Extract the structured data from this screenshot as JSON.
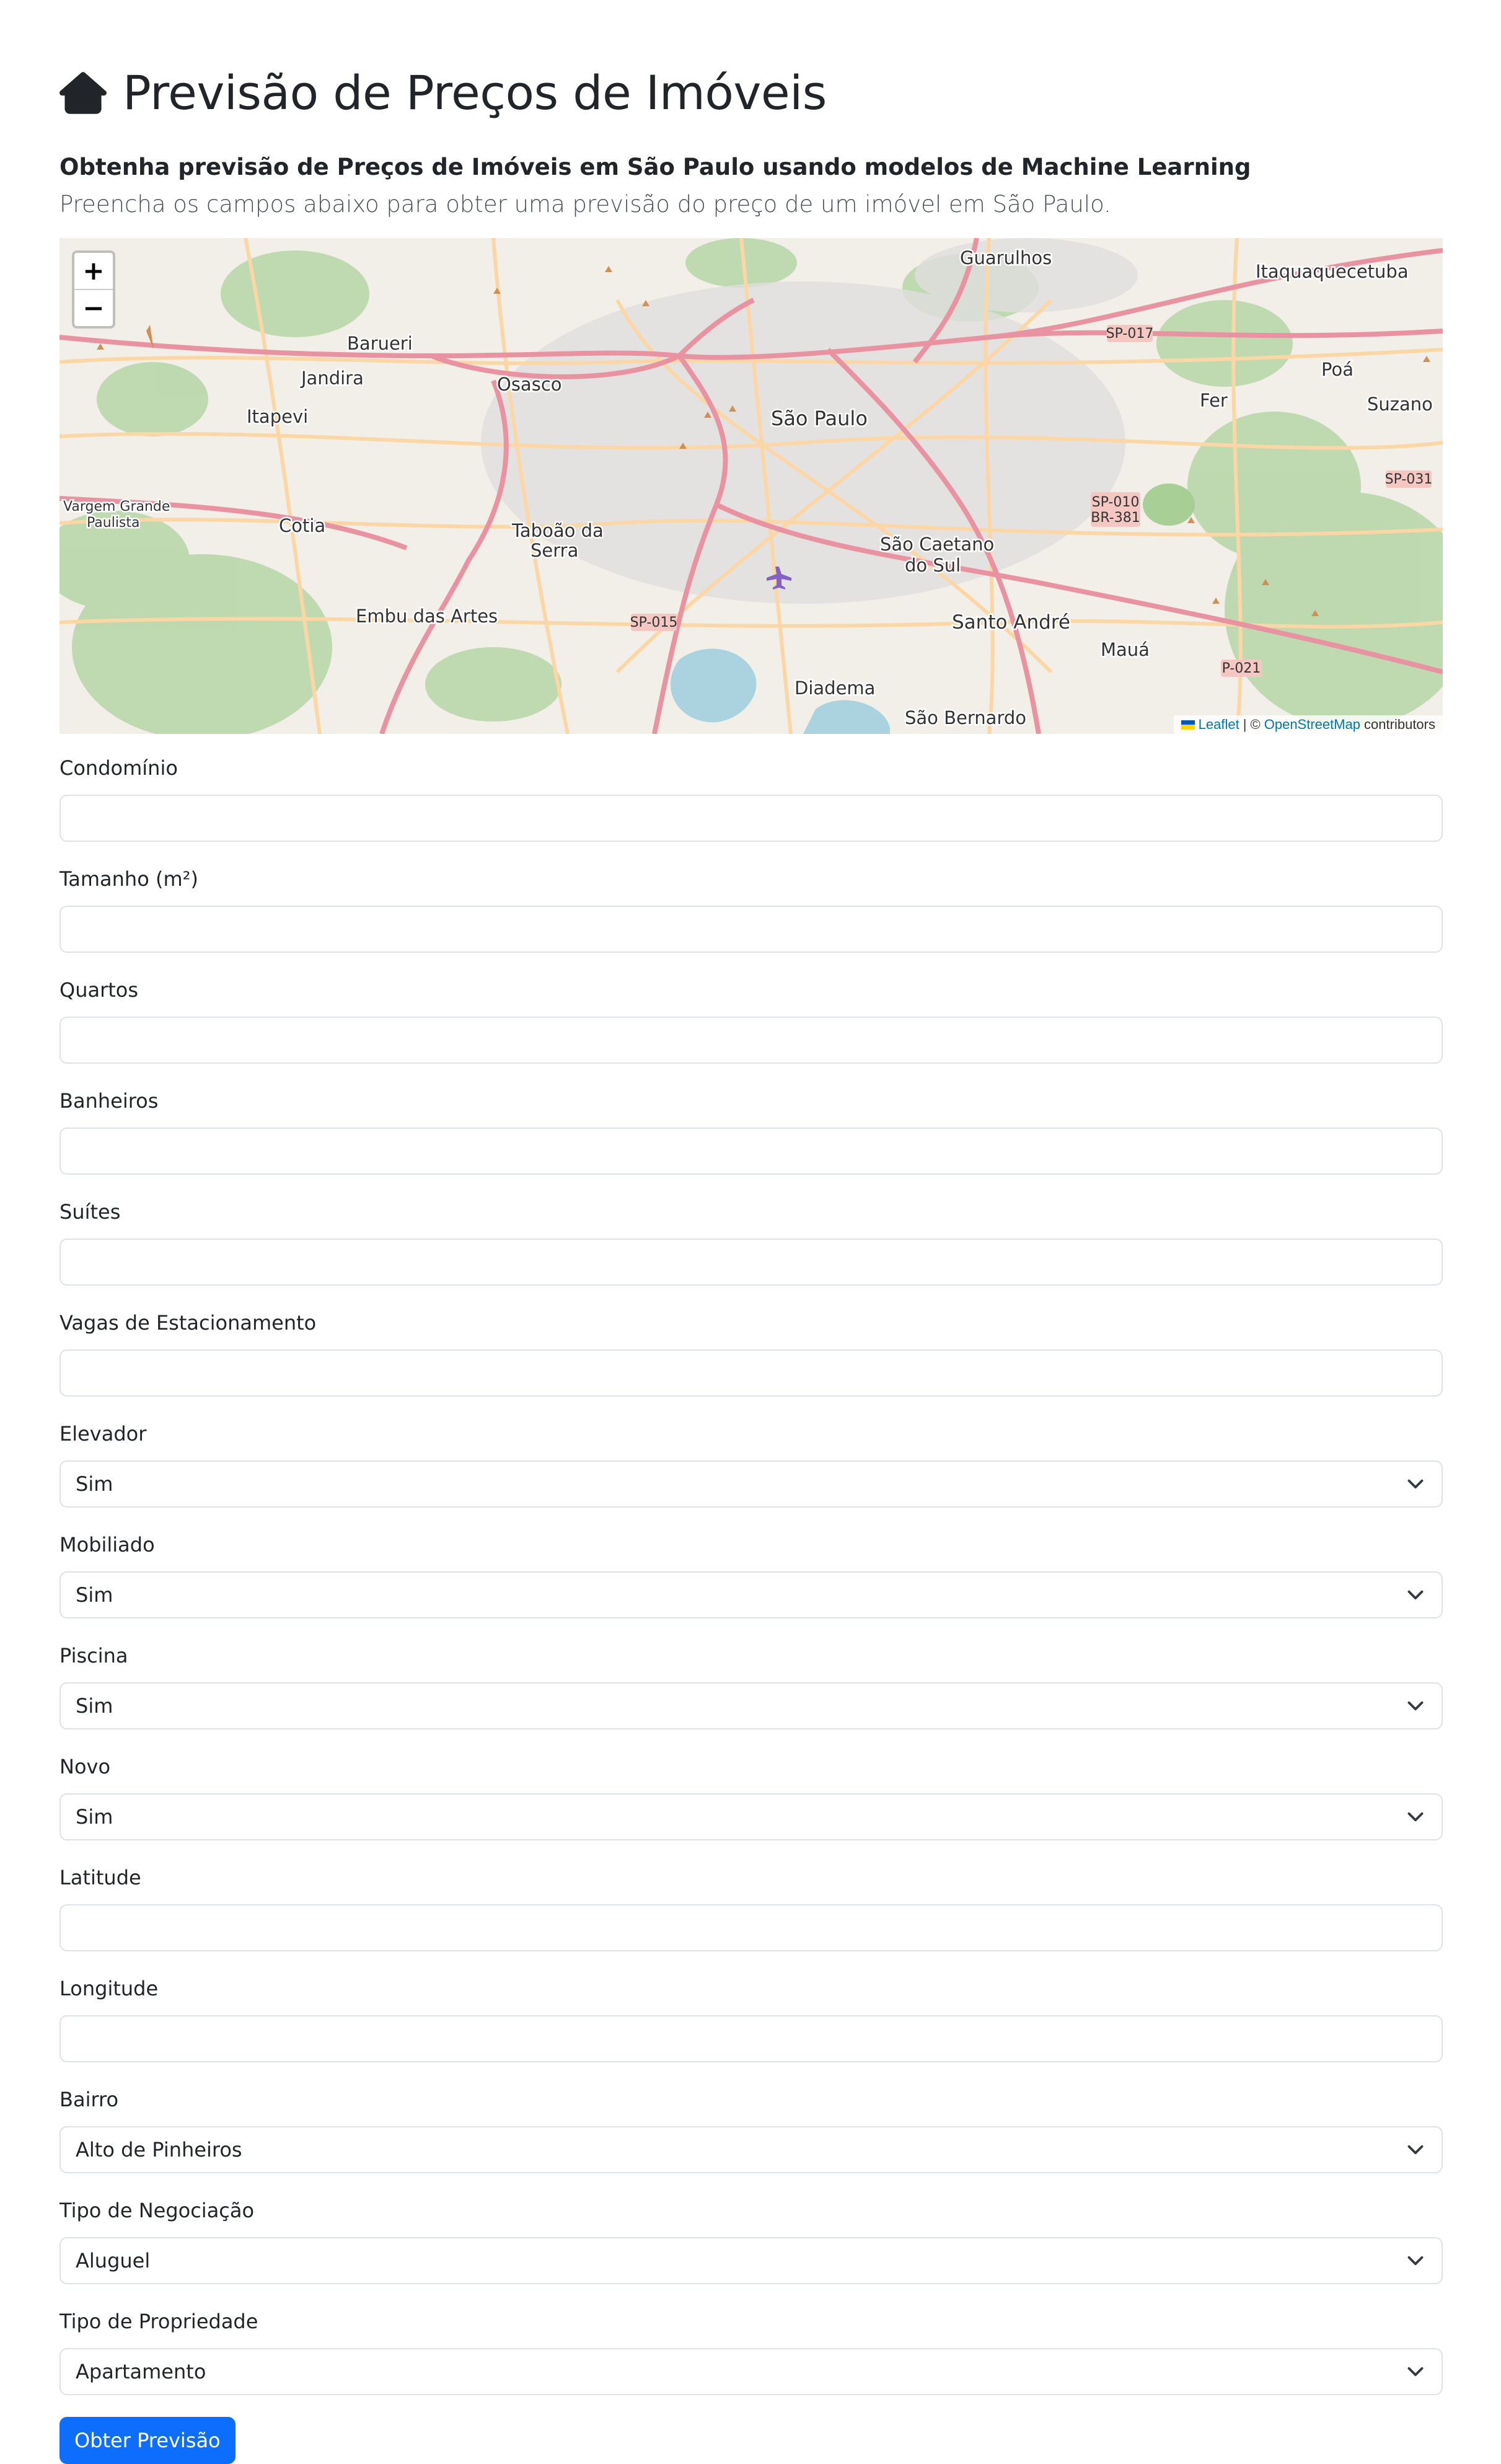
{
  "header": {
    "title": "Previsão de Preços de Imóveis",
    "subtitle": "Obtenha previsão de Preços de Imóveis em São Paulo usando modelos de Machine Learning",
    "lead": "Preencha os campos abaixo para obter uma previsão do preço de um imóvel em São Paulo."
  },
  "map": {
    "zoom_in": "+",
    "zoom_out": "−",
    "attribution": {
      "leaflet": "Leaflet",
      "separator": " | © ",
      "osm": "OpenStreetMap",
      "suffix": " contributors"
    },
    "place_labels": {
      "guarulhos": "Guarulhos",
      "itaquaquecetuba": "Itaquaquecetuba",
      "barueri": "Barueri",
      "jandira": "Jandira",
      "itapevi": "Itapevi",
      "osasco": "Osasco",
      "sao_paulo": "São Paulo",
      "poa": "Poá",
      "suzano": "Suzano",
      "ferraz": "Fer",
      "vargem_grande_1": "Vargem Grande",
      "vargem_grande_2": "Paulista",
      "cotia": "Cotia",
      "taboao_1": "Taboão da",
      "taboao_2": "Serra",
      "sao_caetano_1": "São Caetano",
      "sao_caetano_2": "do Sul",
      "embu": "Embu das Artes",
      "santo_andre": "Santo André",
      "maua": "Mauá",
      "diadema": "Diadema",
      "sao_bernardo": "São Bernardo",
      "sp017": "SP-017",
      "sp031": "SP-031",
      "sp010": "SP-010",
      "br381": "BR-381",
      "sp015": "SP-015",
      "p021": "P-021"
    }
  },
  "form": {
    "condominio": {
      "label": "Condomínio",
      "value": ""
    },
    "tamanho": {
      "label": "Tamanho (m²)",
      "value": ""
    },
    "quartos": {
      "label": "Quartos",
      "value": ""
    },
    "banheiros": {
      "label": "Banheiros",
      "value": ""
    },
    "suites": {
      "label": "Suítes",
      "value": ""
    },
    "vagas": {
      "label": "Vagas de Estacionamento",
      "value": ""
    },
    "elevador": {
      "label": "Elevador",
      "selected": "Sim"
    },
    "mobiliado": {
      "label": "Mobiliado",
      "selected": "Sim"
    },
    "piscina": {
      "label": "Piscina",
      "selected": "Sim"
    },
    "novo": {
      "label": "Novo",
      "selected": "Sim"
    },
    "latitude": {
      "label": "Latitude",
      "value": ""
    },
    "longitude": {
      "label": "Longitude",
      "value": ""
    },
    "bairro": {
      "label": "Bairro",
      "selected": "Alto de Pinheiros"
    },
    "tipo_negociacao": {
      "label": "Tipo de Negociação",
      "selected": "Aluguel"
    },
    "tipo_propriedade": {
      "label": "Tipo de Propriedade",
      "selected": "Apartamento"
    },
    "submit_label": "Obter Previsão"
  },
  "colors": {
    "primary": "#0d6efd",
    "map_background": "#f2efe9",
    "map_green": "#add19e",
    "road_major": "#e892a2",
    "road_secondary": "#fcd6a4"
  }
}
